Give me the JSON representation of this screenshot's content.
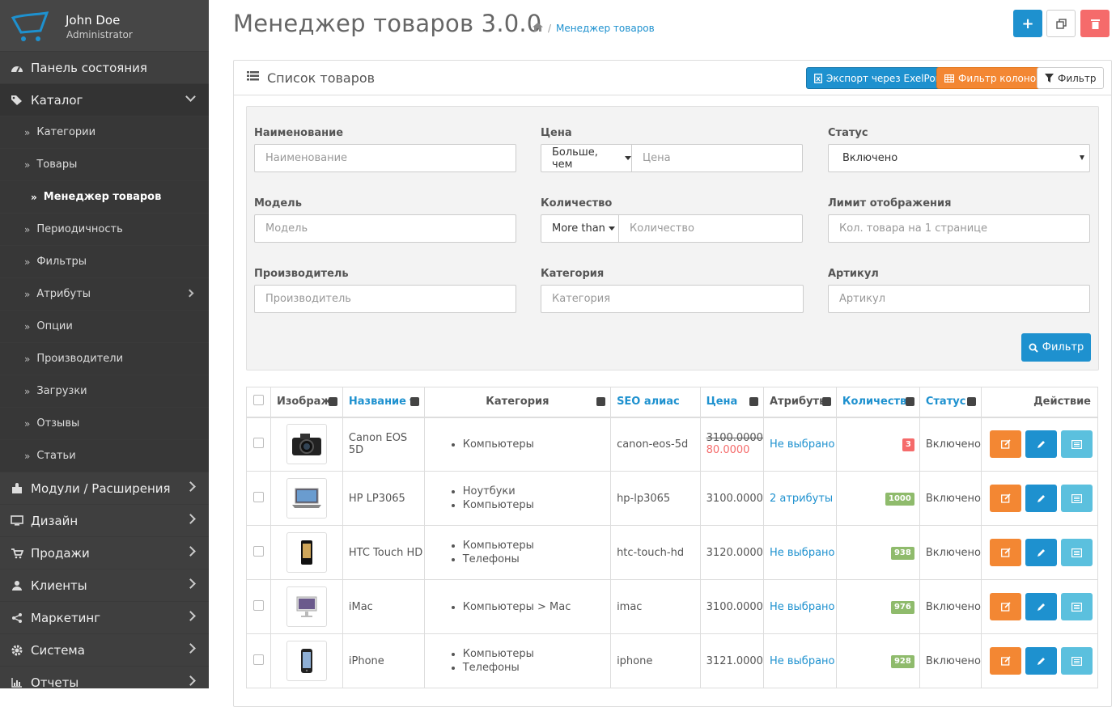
{
  "user": {
    "name": "John Doe",
    "role": "Administrator"
  },
  "nav": {
    "top1": {
      "label": "Панель состояния",
      "icon": "dashboard-icon"
    },
    "catalog": {
      "label": "Каталог",
      "icon": "tags-icon"
    },
    "sub": [
      "Категории",
      "Товары",
      "Менеджер товаров",
      "Периодичность",
      "Фильтры",
      "Атрибуты",
      "Опции",
      "Производители",
      "Загрузки",
      "Отзывы",
      "Статьи"
    ],
    "bottom": [
      {
        "label": "Модули / Расширения",
        "icon": "puzzle-icon"
      },
      {
        "label": "Дизайн",
        "icon": "monitor-icon"
      },
      {
        "label": "Продажи",
        "icon": "cart-icon"
      },
      {
        "label": "Клиенты",
        "icon": "user-icon"
      },
      {
        "label": "Маркетинг",
        "icon": "share-icon"
      },
      {
        "label": "Система",
        "icon": "gear-icon"
      },
      {
        "label": "Отчеты",
        "icon": "bar-chart-icon"
      }
    ]
  },
  "page": {
    "title": "Менеджер товаров 3.0.0",
    "breadcrumb": "Менеджер товаров",
    "toolbar": {
      "add": "+",
      "add_color": "#1e91cf",
      "delete_color": "#f56b6b"
    }
  },
  "panel": {
    "title": "Список товаров",
    "export_label": "Экспорт через ExelPort",
    "columns_label": "Фильтр колонок",
    "filter_label": "Фильтр",
    "colors": {
      "blue": "#1e91cf",
      "orange": "#f38733",
      "cyan": "#5bc0de"
    }
  },
  "filter": {
    "name": {
      "label": "Наименование",
      "placeholder": "Наименование"
    },
    "price": {
      "label": "Цена",
      "mode": "Больше, чем",
      "placeholder": "Цена"
    },
    "status": {
      "label": "Статус",
      "value": "Включено"
    },
    "model": {
      "label": "Модель",
      "placeholder": "Модель"
    },
    "qty": {
      "label": "Количество",
      "mode": "More than",
      "placeholder": "Количество"
    },
    "limit": {
      "label": "Лимит отображения",
      "placeholder": "Кол. товара на 1 странице"
    },
    "manufacturer": {
      "label": "Производитель",
      "placeholder": "Производитель"
    },
    "category": {
      "label": "Категория",
      "placeholder": "Категория"
    },
    "sku": {
      "label": "Артикул",
      "placeholder": "Артикул"
    },
    "button": "Фильтр"
  },
  "table": {
    "headers": {
      "image": "Изображ.",
      "name": "Название",
      "category": "Категория",
      "seo": "SEO алиас",
      "price": "Цена",
      "attrs": "Атрибуты",
      "qty": "Количество",
      "status": "Статус",
      "action": "Действие"
    },
    "rows": [
      {
        "name": "Canon EOS 5D",
        "cats": [
          "Компьютеры"
        ],
        "seo": "canon-eos-5d",
        "price": "3100.0000",
        "special": "80.0000",
        "attrs": "Не выбрано",
        "qty": "3",
        "qty_color": "red",
        "status": "Включено",
        "img": "camera-image"
      },
      {
        "name": "HP LP3065",
        "cats": [
          "Ноутбуки",
          "Компьютеры"
        ],
        "seo": "hp-lp3065",
        "price": "3100.0000",
        "special": "",
        "attrs": "2 атрибуты",
        "qty": "1000",
        "qty_color": "green",
        "status": "Включено",
        "img": "laptop-image"
      },
      {
        "name": "HTC Touch HD",
        "cats": [
          "Компьютеры",
          "Телефоны"
        ],
        "seo": "htc-touch-hd",
        "price": "3120.0000",
        "special": "",
        "attrs": "Не выбрано",
        "qty": "938",
        "qty_color": "green",
        "status": "Включено",
        "img": "phone-image"
      },
      {
        "name": "iMac",
        "cats": [
          "Компьютеры > Mac"
        ],
        "seo": "imac",
        "price": "3100.0000",
        "special": "",
        "attrs": "Не выбрано",
        "qty": "976",
        "qty_color": "green",
        "status": "Включено",
        "img": "imac-image"
      },
      {
        "name": "iPhone",
        "cats": [
          "Компьютеры",
          "Телефоны"
        ],
        "seo": "iphone",
        "price": "3121.0000",
        "special": "",
        "attrs": "Не выбрано",
        "qty": "928",
        "qty_color": "green",
        "status": "Включено",
        "img": "iphone-image"
      }
    ]
  }
}
